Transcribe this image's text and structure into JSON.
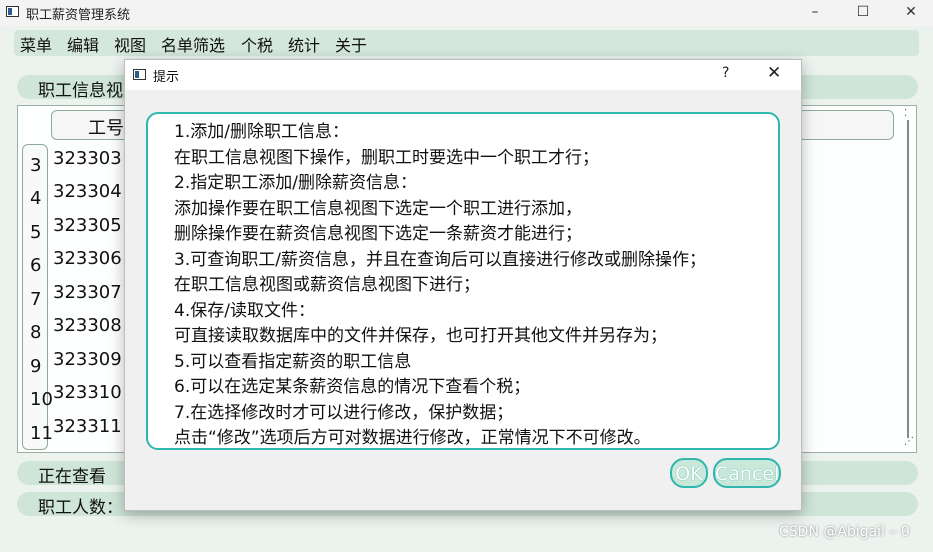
{
  "window": {
    "title": "职工薪资管理系统",
    "controls": {
      "minimize": "–",
      "maximize": "☐",
      "close": "✕"
    }
  },
  "menubar": {
    "items": [
      "菜单",
      "编辑",
      "视图",
      "名单筛选",
      "个税",
      "统计",
      "关于"
    ]
  },
  "main": {
    "section_header": "职工信息视",
    "table": {
      "column_header": "工号",
      "row_numbers": [
        "3",
        "4",
        "5",
        "6",
        "7",
        "8",
        "9",
        "10",
        "11"
      ],
      "ids": [
        "323303",
        "323304",
        "323305",
        "323306",
        "323307",
        "323308",
        "323309",
        "323310",
        "323311"
      ]
    },
    "status_view": "正在查看",
    "status_count": "职工人数："
  },
  "dialog": {
    "title": "提示",
    "help": "?",
    "close": "✕",
    "lines": [
      "1.添加/删除职工信息：",
      "在职工信息视图下操作，删职工时要选中一个职工才行；",
      "2.指定职工添加/删除薪资信息：",
      "添加操作要在职工信息视图下选定一个职工进行添加，",
      "删除操作要在薪资信息视图下选定一条薪资才能进行；",
      "3.可查询职工/薪资信息，并且在查询后可以直接进行修改或删除操作；",
      "在职工信息视图或薪资信息视图下进行；",
      "4.保存/读取文件：",
      "可直接读取数据库中的文件并保存，也可打开其他文件并另存为；",
      "5.可以查看指定薪资的职工信息",
      "6.可以在选定某条薪资信息的情况下查看个税；",
      "7.在选择修改时才可以进行修改，保护数据；",
      "点击“修改”选项后方可对数据进行修改，正常情况下不可修改。"
    ],
    "ok_label": "OK",
    "cancel_label": "Cancel"
  },
  "watermark": "CSDN @Abigail – 0"
}
